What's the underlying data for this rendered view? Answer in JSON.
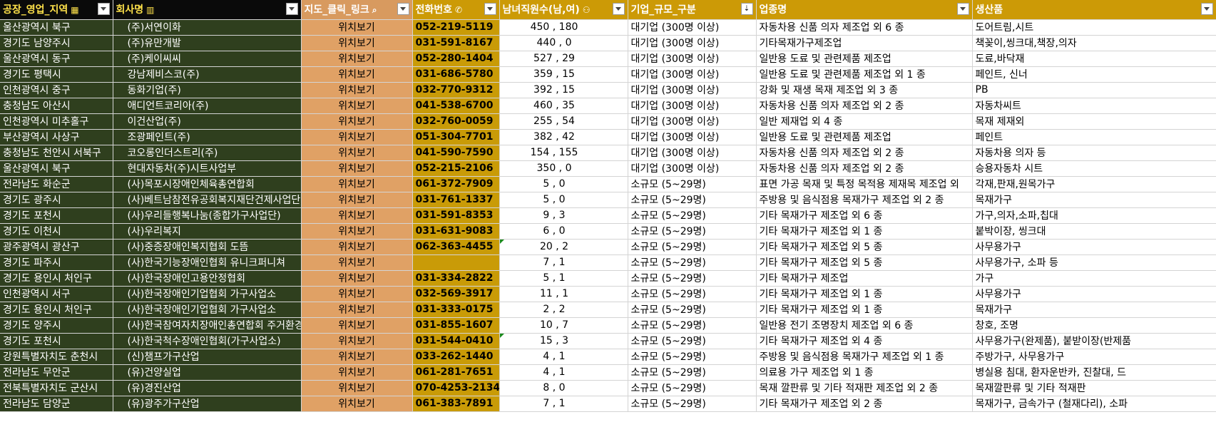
{
  "headers": {
    "region": "공장_영업_지역",
    "company": "회사명",
    "map": "지도_클릭_링크",
    "phone": "전화번호",
    "employees": "남녀직원수(남,여)",
    "size": "기업_규모_구분",
    "industry": "업종명",
    "products": "생산품"
  },
  "icons": {
    "region": "map-icon",
    "company": "building-icon",
    "map": "search-icon",
    "phone": "phone-icon",
    "employees": "people-icon",
    "filter": "filter-dropdown-icon",
    "sort": "sort-descending-icon"
  },
  "rows": [
    {
      "region": "울산광역시 북구",
      "company": "(주)서연이화",
      "map": "위치보기",
      "phone": "052-219-5119",
      "emp": "450 , 180",
      "size": "대기업 (300명 이상)",
      "industry": "자동차용 신품 의자 제조업 외 6 종",
      "products": "도어트림,시트"
    },
    {
      "region": "경기도 남양주시",
      "company": "(주)유만개발",
      "map": "위치보기",
      "phone": "031-591-8167",
      "emp": "440 , 0",
      "size": "대기업 (300명 이상)",
      "industry": "기타목재가구제조업",
      "products": "책꽂이,씽크대,책장,의자"
    },
    {
      "region": "울산광역시 동구",
      "company": "(주)케이씨씨",
      "map": "위치보기",
      "phone": "052-280-1404",
      "emp": "527 , 29",
      "size": "대기업 (300명 이상)",
      "industry": "일반용 도료 및 관련제품 제조업",
      "products": "도료,바닥재"
    },
    {
      "region": "경기도 평택시",
      "company": "강남제비스코(주)",
      "map": "위치보기",
      "phone": "031-686-5780",
      "emp": "359 , 15",
      "size": "대기업 (300명 이상)",
      "industry": "일반용 도료 및 관련제품 제조업 외 1 종",
      "products": "페인트, 신너"
    },
    {
      "region": "인천광역시 중구",
      "company": "동화기업(주)",
      "map": "위치보기",
      "phone": "032-770-9312",
      "emp": "392 , 15",
      "size": "대기업 (300명 이상)",
      "industry": "강화 및 재생 목재 제조업 외 3 종",
      "products": "PB"
    },
    {
      "region": "충청남도 아산시",
      "company": "애디언트코리아(주)",
      "map": "위치보기",
      "phone": "041-538-6700",
      "emp": "460 , 35",
      "size": "대기업 (300명 이상)",
      "industry": "자동차용 신품 의자 제조업 외 2 종",
      "products": "자동차씨트"
    },
    {
      "region": "인천광역시 미추홀구",
      "company": "이건산업(주)",
      "map": "위치보기",
      "phone": "032-760-0059",
      "emp": "255 , 54",
      "size": "대기업 (300명 이상)",
      "industry": "일반 제재업 외 4 종",
      "products": "목재 제재외"
    },
    {
      "region": "부산광역시 사상구",
      "company": "조광페인트(주)",
      "map": "위치보기",
      "phone": "051-304-7701",
      "emp": "382 , 42",
      "size": "대기업 (300명 이상)",
      "industry": "일반용 도료 및 관련제품 제조업",
      "products": "페인트"
    },
    {
      "region": "충청남도 천안시 서북구",
      "company": "코오롱인더스트리(주)",
      "map": "위치보기",
      "phone": "041-590-7590",
      "emp": "154 , 155",
      "size": "대기업 (300명 이상)",
      "industry": "자동차용 신품 의자 제조업 외 2 종",
      "products": "자동차용 의자 등"
    },
    {
      "region": "울산광역시 북구",
      "company": "현대자동차(주)시트사업부",
      "map": "위치보기",
      "phone": "052-215-2106",
      "emp": "350 , 0",
      "size": "대기업 (300명 이상)",
      "industry": "자동차용 신품 의자 제조업 외 2 종",
      "products": "승용자동차 시트"
    },
    {
      "region": "전라남도 화순군",
      "company": "(사)목포시장애인체육총연합회",
      "map": "위치보기",
      "phone": "061-372-7909",
      "emp": "5 , 0",
      "size": "소규모 (5~29명)",
      "industry": "표면 가공 목재 및 특정 목적용 제재목 제조업 외",
      "products": "각재,판재,원목가구"
    },
    {
      "region": "경기도 광주시",
      "company": "(사)베트남참전유공회복지재단건제사업단",
      "map": "위치보기",
      "phone": "031-761-1337",
      "emp": "5 , 0",
      "size": "소규모 (5~29명)",
      "industry": "주방용 및 음식점용 목재가구 제조업 외 2 종",
      "products": "목재가구"
    },
    {
      "region": "경기도 포천시",
      "company": "(사)우리들행복나눔(종합가구사업단)",
      "map": "위치보기",
      "phone": "031-591-8353",
      "emp": "9 , 3",
      "size": "소규모 (5~29명)",
      "industry": "기타 목재가구 제조업 외 6 종",
      "products": "가구,의자,소파,칩대"
    },
    {
      "region": "경기도 이천시",
      "company": "(사)우리복지",
      "map": "위치보기",
      "phone": "031-631-9083",
      "emp": "6 , 0",
      "size": "소규모 (5~29명)",
      "industry": "기타 목재가구 제조업 외 1 종",
      "products": "붙박이장, 씽크대"
    },
    {
      "region": "광주광역시 광산구",
      "company": "(사)중증장애인복지협회 도뜸",
      "map": "위치보기",
      "phone": "062-363-4455",
      "emp": "20 , 2",
      "size": "소규모 (5~29명)",
      "industry": "기타 목재가구 제조업 외 5 종",
      "products": "사무용가구",
      "marker": true
    },
    {
      "region": "경기도 파주시",
      "company": "(사)한국기능장애인협회  유니크퍼니쳐",
      "map": "위치보기",
      "phone": "",
      "emp": "7 , 1",
      "size": "소규모 (5~29명)",
      "industry": "기타 목재가구 제조업 외 5 종",
      "products": "사무용가구, 소파 등"
    },
    {
      "region": "경기도 용인시 처인구",
      "company": "(사)한국장애인고용안정협회",
      "map": "위치보기",
      "phone": "031-334-2822",
      "emp": "5 , 1",
      "size": "소규모 (5~29명)",
      "industry": "기타 목재가구 제조업",
      "products": "가구"
    },
    {
      "region": "인천광역시 서구",
      "company": "(사)한국장애인기업협회 가구사업소",
      "map": "위치보기",
      "phone": "032-569-3917",
      "emp": "11 , 1",
      "size": "소규모 (5~29명)",
      "industry": "기타 목재가구 제조업 외 1 종",
      "products": "사무용가구"
    },
    {
      "region": "경기도 용인시 처인구",
      "company": "(사)한국장애인기업협회 가구사업소",
      "map": "위치보기",
      "phone": "031-333-0175",
      "emp": "2 , 2",
      "size": "소규모 (5~29명)",
      "industry": "기타 목재가구 제조업 외 1 종",
      "products": "목재가구"
    },
    {
      "region": "경기도 양주시",
      "company": "(사)한국참여자치장애인총연합회 주거환경",
      "map": "위치보기",
      "phone": "031-855-1607",
      "emp": "10 , 7",
      "size": "소규모 (5~29명)",
      "industry": "일반용 전기 조명장치 제조업 외 6 종",
      "products": "창호, 조명"
    },
    {
      "region": "경기도 포천시",
      "company": "(사)한국척수장애인협회(가구사업소)",
      "map": "위치보기",
      "phone": "031-544-0410",
      "emp": "15 , 3",
      "size": "소규모 (5~29명)",
      "industry": "기타 목재가구 제조업 외 4 종",
      "products": "사무용가구(완제품), 붙받이장(반제품",
      "marker": true
    },
    {
      "region": "강원특별자치도 춘천시",
      "company": "(신)챔프가구산업",
      "map": "위치보기",
      "phone": "033-262-1440",
      "emp": "4 , 1",
      "size": "소규모 (5~29명)",
      "industry": "주방용 및 음식점용 목재가구 제조업 외 1 종",
      "products": "주방가구, 사무용가구"
    },
    {
      "region": "전라남도 무안군",
      "company": "(유)건양실업",
      "map": "위치보기",
      "phone": "061-281-7651",
      "emp": "4 , 1",
      "size": "소규모 (5~29명)",
      "industry": "의료용 가구 제조업 외 1 종",
      "products": "병실용 침대, 환자운반카, 진찰대, 드"
    },
    {
      "region": "전북특별자치도 군산시",
      "company": "(유)경진산업",
      "map": "위치보기",
      "phone": "070-4253-2134",
      "emp": "8 , 0",
      "size": "소규모 (5~29명)",
      "industry": "목재 깔판류 및 기타 적재판 제조업 외 2 종",
      "products": "목재깔판류 및 기타 적재판"
    },
    {
      "region": "전라남도 담양군",
      "company": "(유)광주가구산업",
      "map": "위치보기",
      "phone": "061-383-7891",
      "emp": "7 , 1",
      "size": "소규모 (5~29명)",
      "industry": "기타 목재가구 제조업 외 2 종",
      "products": "목재가구, 금속가구 (철재다리), 소파"
    }
  ]
}
